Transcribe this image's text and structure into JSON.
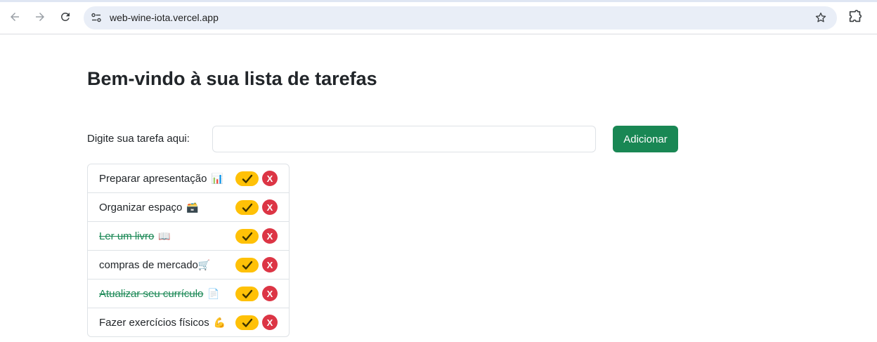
{
  "browser": {
    "url": "web-wine-iota.vercel.app"
  },
  "page": {
    "title": "Bem-vindo à sua lista de tarefas",
    "input_label": "Digite sua tarefa aqui:",
    "input_value": "",
    "add_button": "Adicionar"
  },
  "tasks": [
    {
      "text": "Preparar apresentação",
      "emoji": "📊",
      "done": false,
      "done_label": "✓",
      "delete_label": "X"
    },
    {
      "text": "Organizar espaço",
      "emoji": "🗃️",
      "done": false,
      "done_label": "✓",
      "delete_label": "X"
    },
    {
      "text": "Ler um livro",
      "emoji": "📖",
      "done": true,
      "done_label": "✓",
      "delete_label": "X"
    },
    {
      "text": "compras de mercado",
      "emoji": "🛒",
      "done": false,
      "done_label": "✓",
      "delete_label": "X"
    },
    {
      "text": "Atualizar seu currículo",
      "emoji": "📄",
      "done": true,
      "done_label": "✓",
      "delete_label": "X"
    },
    {
      "text": "Fazer exercícios físicos",
      "emoji": "💪",
      "done": false,
      "done_label": "✓",
      "delete_label": "X"
    }
  ],
  "colors": {
    "add_button": "#198754",
    "done_text": "#198754",
    "check_button": "#ffc107",
    "delete_button": "#dc3545"
  }
}
